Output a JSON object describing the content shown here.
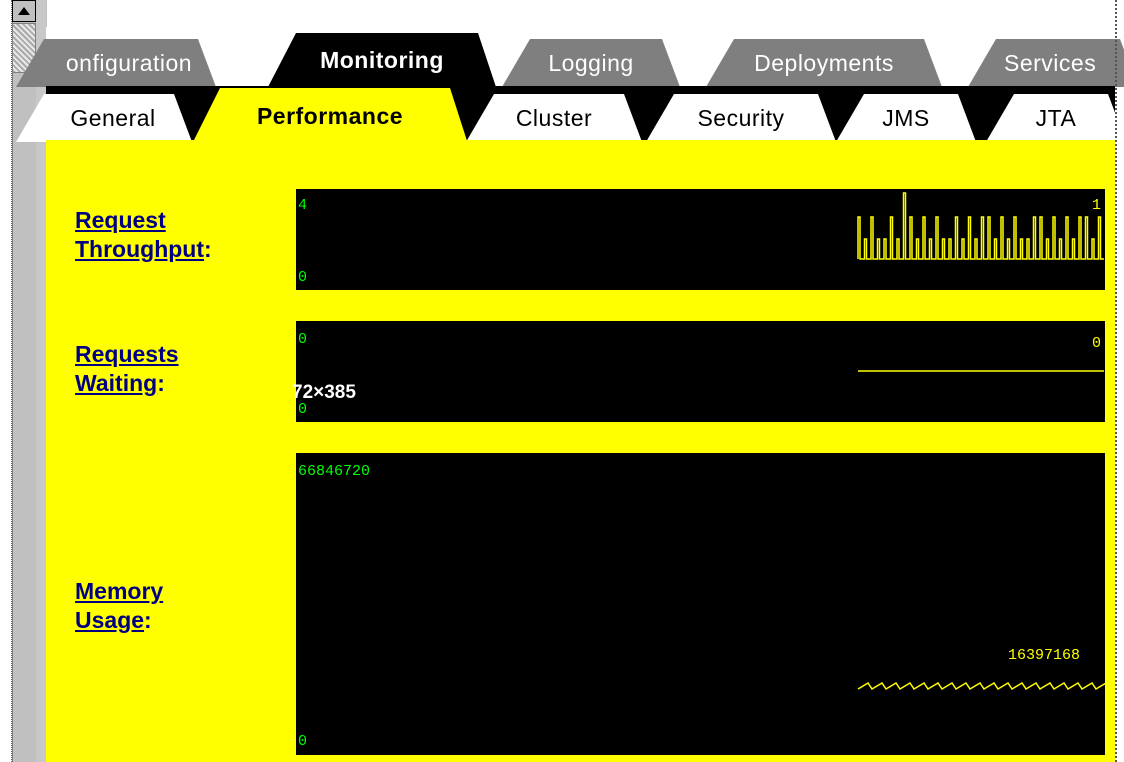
{
  "tabs_top": [
    {
      "label": "onfiguration",
      "active": false
    },
    {
      "label": "Monitoring",
      "active": true
    },
    {
      "label": "Logging",
      "active": false
    },
    {
      "label": "Deployments",
      "active": false
    },
    {
      "label": "Services",
      "active": false
    }
  ],
  "tabs_sub": [
    {
      "label": "General",
      "active": false
    },
    {
      "label": "Performance",
      "active": true
    },
    {
      "label": "Cluster",
      "active": false
    },
    {
      "label": "Security",
      "active": false
    },
    {
      "label": "JMS",
      "active": false
    },
    {
      "label": "JTA",
      "active": false
    }
  ],
  "metrics": {
    "throughput": {
      "label_line1": "Request",
      "label_line2": "Throughput",
      "colon": ":",
      "max": "4",
      "min": "0",
      "current": "1"
    },
    "waiting": {
      "label_line1": "Requests",
      "label_line2": "Waiting",
      "colon": ":",
      "max": "0",
      "min": "0",
      "current": "0"
    },
    "memory": {
      "label_line1": "Memory",
      "label_line2": "Usage",
      "colon": ":",
      "max": "66846720",
      "min": "0",
      "current": "16397168"
    }
  },
  "overlay_text": "72×385",
  "colors": {
    "background": "#ffff00",
    "graph_bg": "#000000",
    "axis_text": "#00ff00",
    "trace": "#ffff00",
    "link": "#000080"
  }
}
